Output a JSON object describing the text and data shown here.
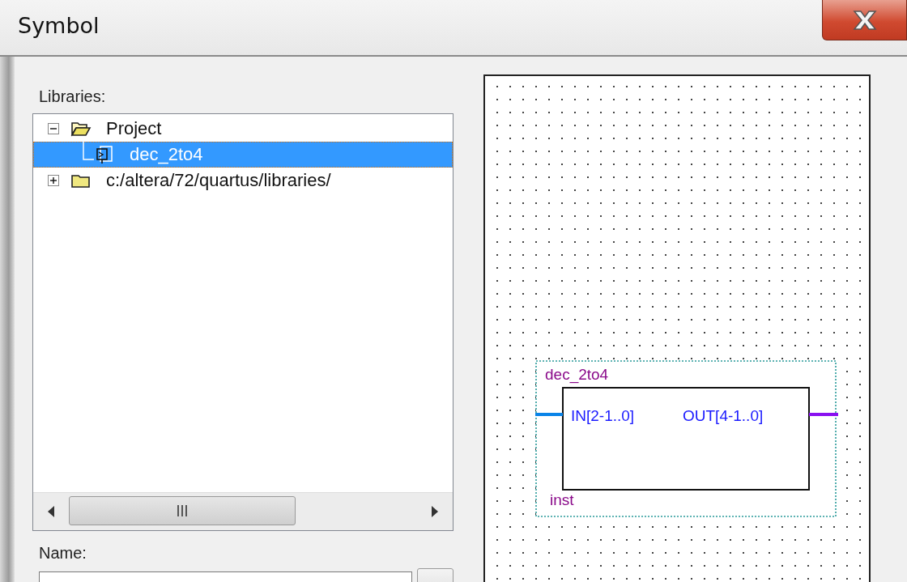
{
  "window": {
    "title": "Symbol"
  },
  "libraries": {
    "label": "Libraries:",
    "tree": [
      {
        "label": "Project",
        "expanded": true,
        "selected": false,
        "children": [
          {
            "label": "dec_2to4",
            "selected": true
          }
        ]
      },
      {
        "label": "c:/altera/72/quartus/libraries/",
        "expanded": false,
        "selected": false
      }
    ]
  },
  "name": {
    "label": "Name:"
  },
  "preview": {
    "symbol": {
      "name": "dec_2to4",
      "instance": "inst",
      "inputs": [
        "IN[2-1..0]"
      ],
      "outputs": [
        "OUT[4-1..0]"
      ]
    }
  }
}
